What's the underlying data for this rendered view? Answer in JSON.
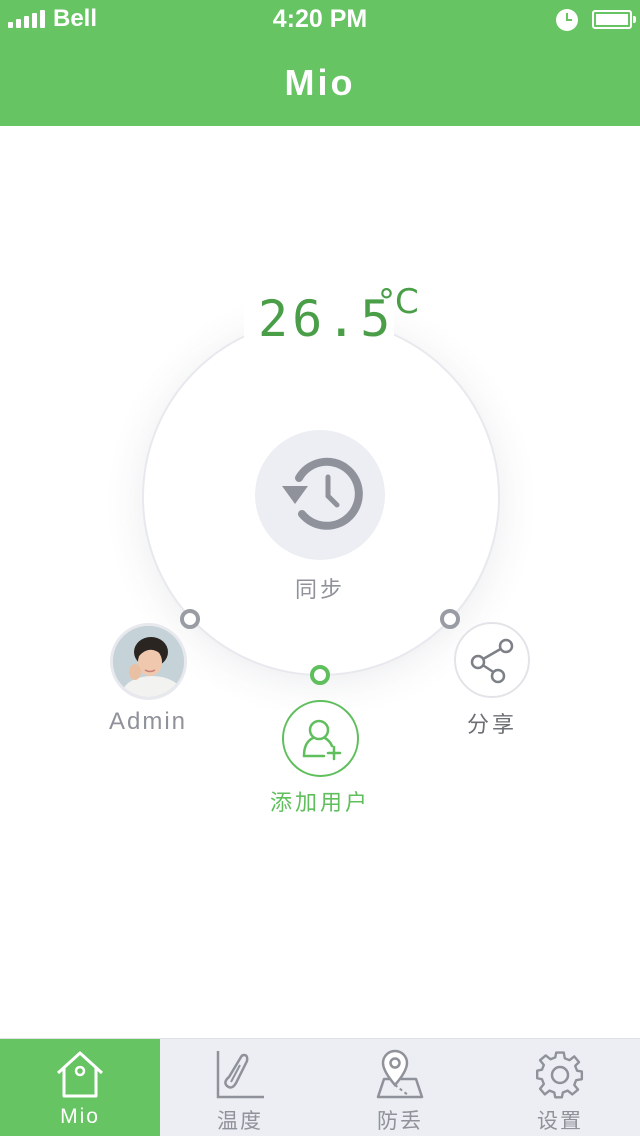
{
  "status_bar": {
    "carrier": "Bell",
    "time": "4:20 PM",
    "signal_icon": "signal-bars-icon",
    "alarm_icon": "alarm-clock-icon",
    "battery_icon": "battery-icon"
  },
  "header": {
    "title": "Mio"
  },
  "main": {
    "temperature": "26.5",
    "temperature_unit": "°C",
    "sync": {
      "label": "同步",
      "icon": "history-clock-icon"
    },
    "users": [
      {
        "label": "Admin",
        "icon": "avatar"
      },
      {
        "label": "添加用户",
        "icon": "add-user-icon"
      }
    ],
    "share": {
      "label": "分享",
      "icon": "share-icon"
    }
  },
  "tabs": [
    {
      "label": "Mio",
      "icon": "home-icon",
      "active": true
    },
    {
      "label": "温度",
      "icon": "thermometer-chart-icon",
      "active": false
    },
    {
      "label": "防丢",
      "icon": "map-pin-icon",
      "active": false
    },
    {
      "label": "设置",
      "icon": "gear-icon",
      "active": false
    }
  ],
  "colors": {
    "brand_green": "#66c463",
    "temp_green": "#4a9e48",
    "tab_bg": "#eceef3",
    "muted_text": "#8f929a"
  }
}
